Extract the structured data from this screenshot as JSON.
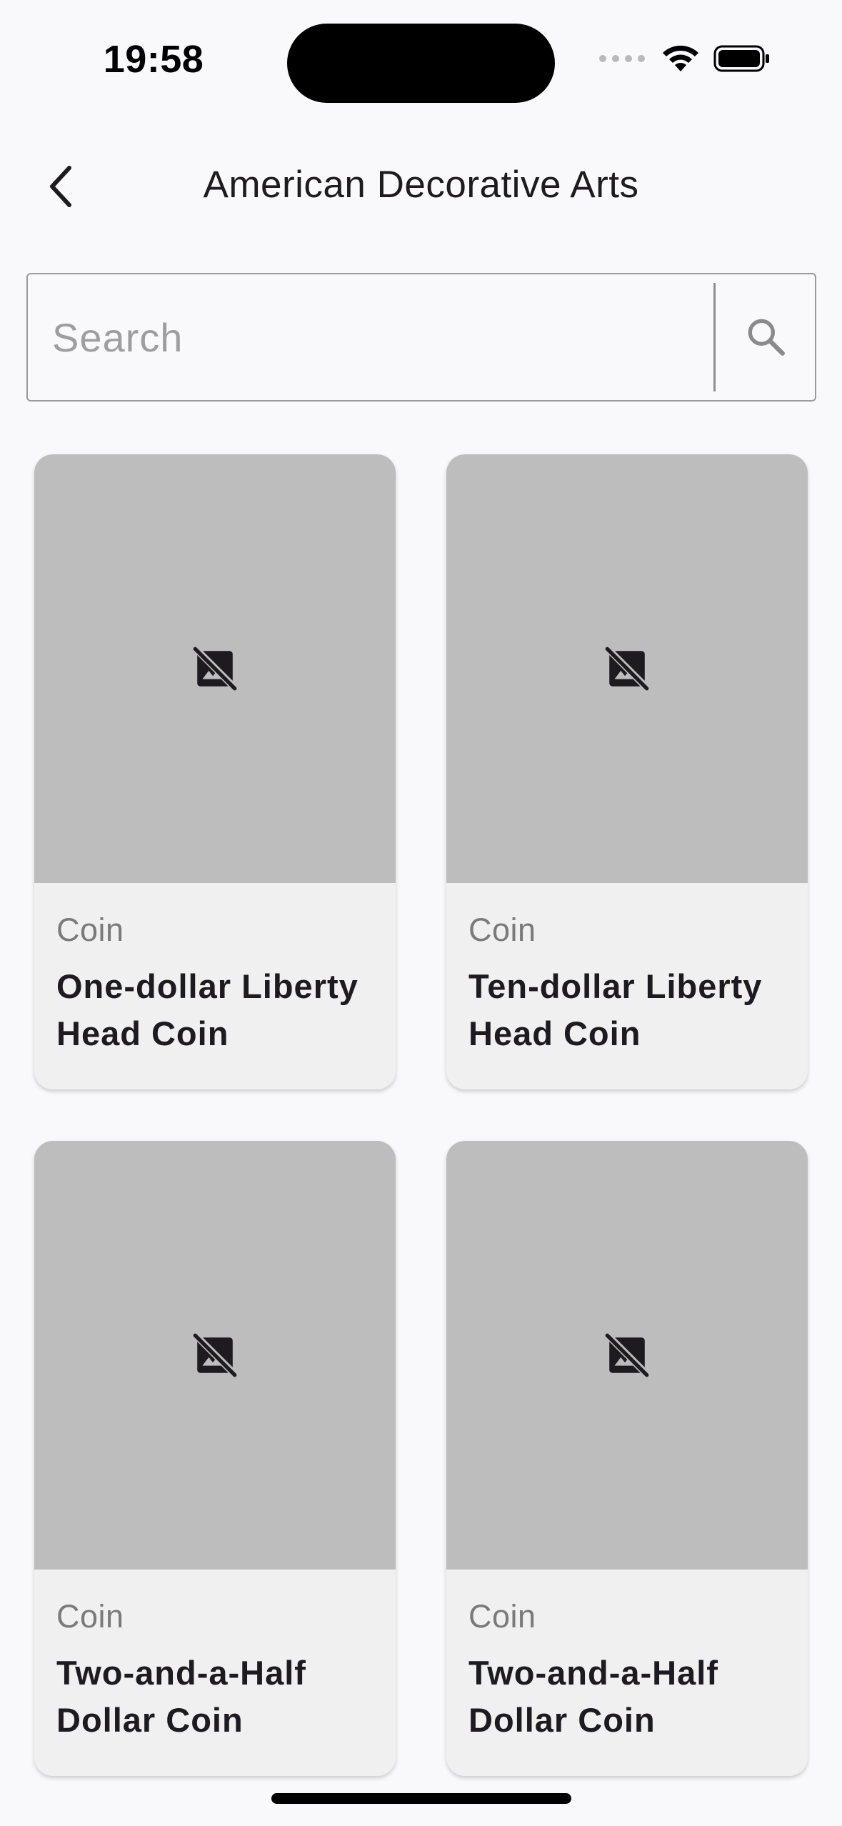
{
  "status_bar": {
    "time": "19:58"
  },
  "header": {
    "title": "American Decorative Arts",
    "back_icon": "chevron-left-icon"
  },
  "search": {
    "placeholder": "Search",
    "value": "",
    "icon": "search-icon"
  },
  "items": [
    {
      "category": "Coin",
      "title": "One-dollar Liberty Head Coin",
      "image_icon": "image-not-supported-icon"
    },
    {
      "category": "Coin",
      "title": "Ten-dollar Liberty Head Coin",
      "image_icon": "image-not-supported-icon"
    },
    {
      "category": "Coin",
      "title": "Two-and-a-Half Dollar Coin",
      "image_icon": "image-not-supported-icon"
    },
    {
      "category": "Coin",
      "title": "Two-and-a-Half Dollar Coin",
      "image_icon": "image-not-supported-icon"
    }
  ],
  "colors": {
    "background": "#f9f9fb",
    "card_image_placeholder": "#bdbdbd",
    "card_body": "#f0f0f0",
    "category_text": "#7a7a7a"
  }
}
